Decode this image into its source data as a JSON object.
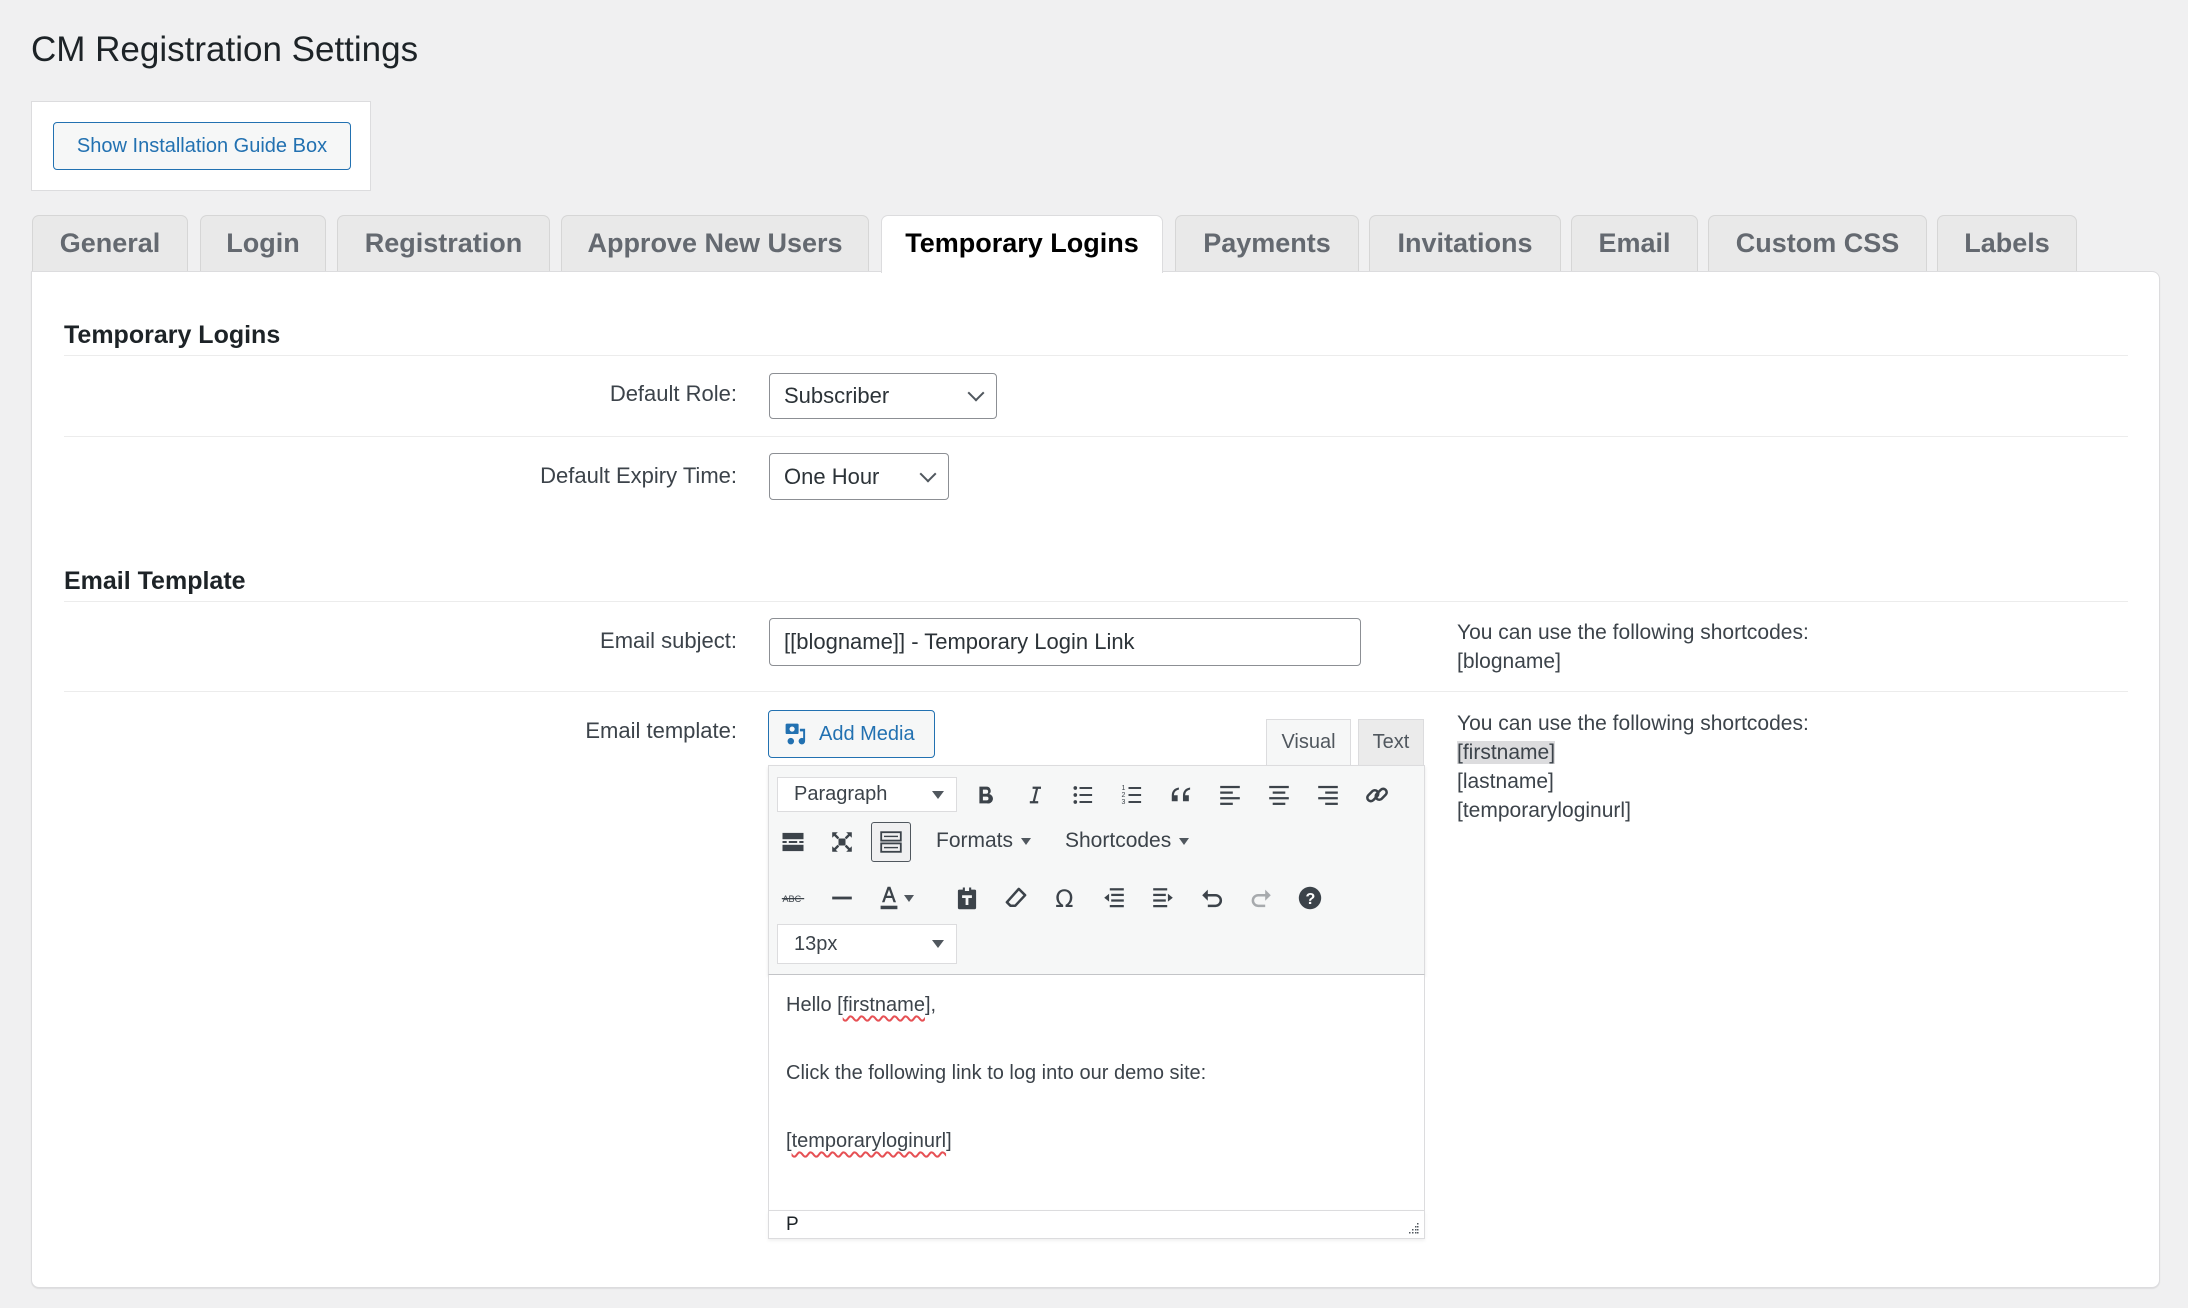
{
  "page": {
    "title": "CM Registration Settings"
  },
  "guide": {
    "button_label": "Show Installation Guide Box"
  },
  "tabs": [
    {
      "label": "General",
      "active": false
    },
    {
      "label": "Login",
      "active": false
    },
    {
      "label": "Registration",
      "active": false
    },
    {
      "label": "Approve New Users",
      "active": false
    },
    {
      "label": "Temporary Logins",
      "active": true
    },
    {
      "label": "Payments",
      "active": false
    },
    {
      "label": "Invitations",
      "active": false
    },
    {
      "label": "Email",
      "active": false
    },
    {
      "label": "Custom CSS",
      "active": false
    },
    {
      "label": "Labels",
      "active": false
    }
  ],
  "temporary_logins": {
    "section_title": "Temporary Logins",
    "default_role": {
      "label": "Default Role:",
      "value": "Subscriber"
    },
    "default_expiry": {
      "label": "Default Expiry Time:",
      "value": "One Hour"
    }
  },
  "email_template": {
    "section_title": "Email Template",
    "subject": {
      "label": "Email subject:",
      "value": "[[blogname]] - Temporary Login Link",
      "hint_intro": "You can use the following shortcodes:",
      "shortcodes": [
        "[blogname]"
      ]
    },
    "template": {
      "label": "Email template:",
      "add_media_label": "Add Media",
      "visual_tab": "Visual",
      "text_tab": "Text",
      "hint_intro": "You can use the following shortcodes:",
      "shortcodes": [
        "[firstname]",
        "[lastname]",
        "[temporaryloginurl]"
      ],
      "toolbar": {
        "format_select": "Paragraph",
        "formats_menu": "Formats",
        "shortcodes_menu": "Shortcodes",
        "font_size_select": "13px"
      },
      "body": {
        "line1_prefix": "Hello ",
        "line1_code": "[firstname]",
        "line1_suffix": ",",
        "line2": "Click the following link to log into our demo site:",
        "line3_open": "[",
        "line3_code": "temporaryloginurl",
        "line3_close": "]"
      },
      "status_path": "P"
    }
  }
}
